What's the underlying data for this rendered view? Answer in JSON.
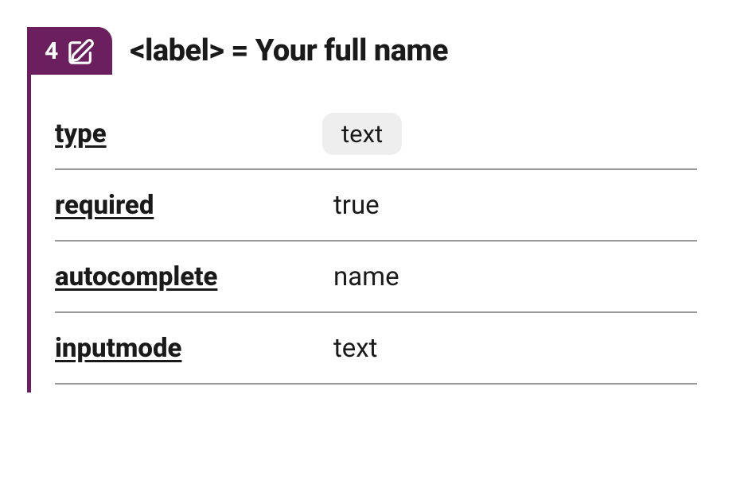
{
  "badge": {
    "number": "4"
  },
  "title": "<label> = Your full name",
  "rows": [
    {
      "label": "type",
      "value": "text",
      "chip": true
    },
    {
      "label": "required",
      "value": "true",
      "chip": false
    },
    {
      "label": "autocomplete",
      "value": "name",
      "chip": false
    },
    {
      "label": "inputmode",
      "value": "text",
      "chip": false
    }
  ]
}
